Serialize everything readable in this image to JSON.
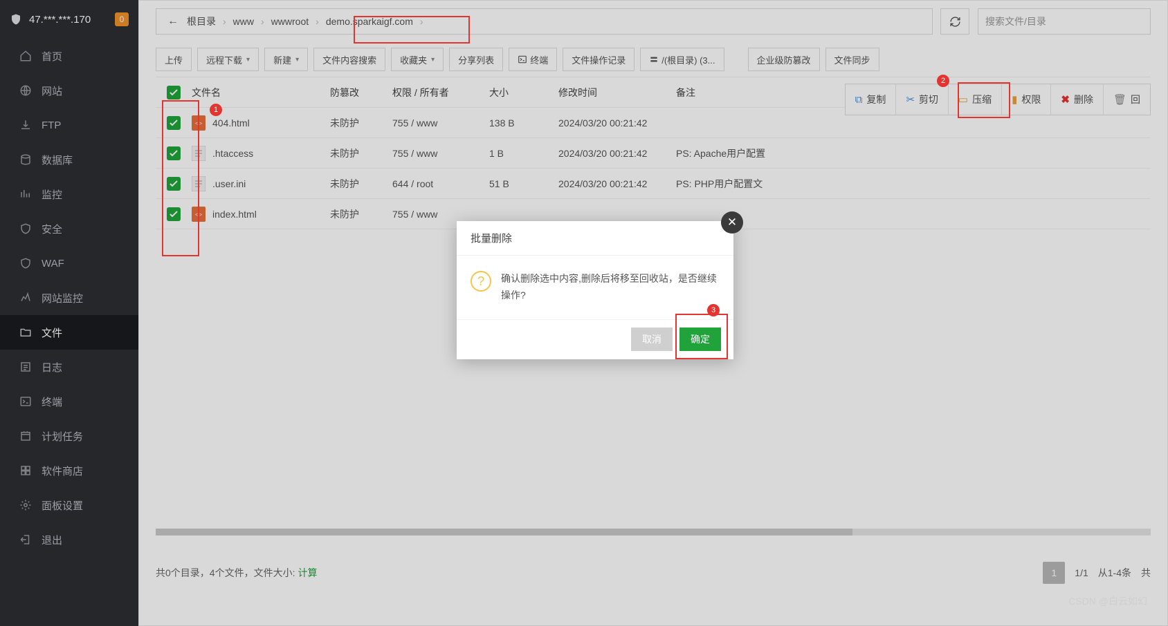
{
  "header": {
    "ip": "47.***.***.170",
    "badge": "0"
  },
  "sidebar": {
    "items": [
      {
        "label": "首页"
      },
      {
        "label": "网站"
      },
      {
        "label": "FTP"
      },
      {
        "label": "数据库"
      },
      {
        "label": "监控"
      },
      {
        "label": "安全"
      },
      {
        "label": "WAF"
      },
      {
        "label": "网站监控"
      },
      {
        "label": "文件"
      },
      {
        "label": "日志"
      },
      {
        "label": "终端"
      },
      {
        "label": "计划任务"
      },
      {
        "label": "软件商店"
      },
      {
        "label": "面板设置"
      },
      {
        "label": "退出"
      }
    ]
  },
  "breadcrumb": {
    "segs": [
      "根目录",
      "www",
      "wwwroot",
      "demo.sparkaigf.com"
    ]
  },
  "search": {
    "placeholder": "搜索文件/目录"
  },
  "toolbar": {
    "upload": "上传",
    "remote": "远程下载",
    "new": "新建",
    "content_search": "文件内容搜索",
    "fav": "收藏夹",
    "share": "分享列表",
    "terminal": "终端",
    "oplog": "文件操作记录",
    "mount": "/(根目录) (3...",
    "tamper": "企业级防篡改",
    "sync": "文件同步"
  },
  "actions": {
    "copy": "复制",
    "cut": "剪切",
    "zip": "压缩",
    "perm": "权限",
    "delete": "删除",
    "recycle": "回"
  },
  "table": {
    "headers": {
      "name": "文件名",
      "tamper": "防篡改",
      "perm": "权限 / 所有者",
      "size": "大小",
      "time": "修改时间",
      "note": "备注"
    },
    "rows": [
      {
        "name": "404.html",
        "tamper": "未防护",
        "perm": "755 / www",
        "size": "138 B",
        "time": "2024/03/20 00:21:42",
        "note": "",
        "icon": "html"
      },
      {
        "name": ".htaccess",
        "tamper": "未防护",
        "perm": "755 / www",
        "size": "1 B",
        "time": "2024/03/20 00:21:42",
        "note": "PS: Apache用户配置",
        "icon": "txt"
      },
      {
        "name": ".user.ini",
        "tamper": "未防护",
        "perm": "644 / root",
        "size": "51 B",
        "time": "2024/03/20 00:21:42",
        "note": "PS: PHP用户配置文",
        "icon": "txt"
      },
      {
        "name": "index.html",
        "tamper": "未防护",
        "perm": "755 / www",
        "size": "",
        "time": "",
        "note": "",
        "icon": "html"
      }
    ]
  },
  "footer": {
    "summary_prefix": "共0个目录，4个文件，文件大小: ",
    "summary_calc": "计算",
    "page_cur": "1",
    "page_total": "1/1",
    "range": "从1-4条",
    "suffix": "共"
  },
  "modal": {
    "title": "批量删除",
    "message": "确认删除选中内容,删除后将移至回收站，是否继续操作?",
    "cancel": "取消",
    "confirm": "确定"
  },
  "badges": {
    "b1": "1",
    "b2": "2",
    "b3": "3"
  },
  "watermark": "CSDN @白云如幻"
}
